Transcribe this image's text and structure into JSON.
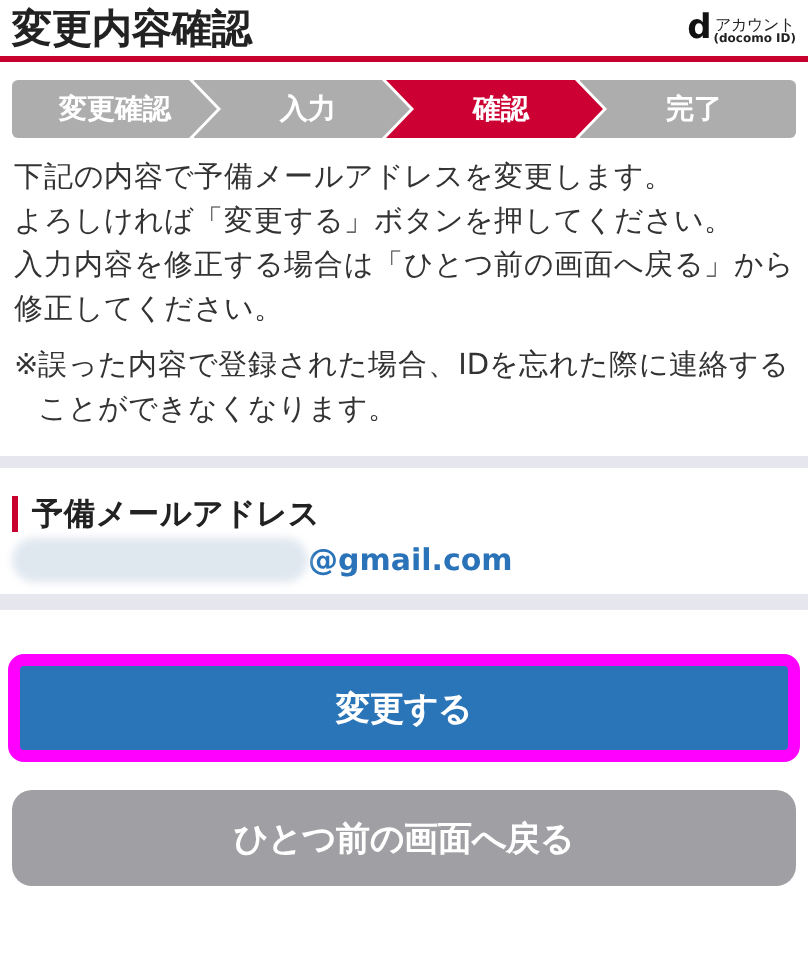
{
  "header": {
    "title": "変更内容確認",
    "logo": {
      "mark": "d",
      "name": "アカウント",
      "sub": "(docomo ID)"
    }
  },
  "steps": [
    {
      "label": "変更確認",
      "selected": false
    },
    {
      "label": "入力",
      "selected": false
    },
    {
      "label": "確認",
      "selected": true
    },
    {
      "label": "完了",
      "selected": false
    }
  ],
  "intro": [
    "下記の内容で予備メールアドレスを変更します。",
    "よろしければ「変更する」ボタンを押してください。",
    "入力内容を修正する場合は「ひとつ前の画面へ戻る」から修正してください。"
  ],
  "note": {
    "mark": "※",
    "text": "誤った内容で登録された場合、IDを忘れた際に連絡することができなくなります。"
  },
  "field": {
    "label": "予備メールアドレス",
    "value": "@gmail.com",
    "redacted": true
  },
  "buttons": [
    {
      "label": "変更する",
      "kind": "primary",
      "highlighted": true
    },
    {
      "label": "ひとつ前の画面へ戻る",
      "kind": "secondary",
      "highlighted": false
    }
  ]
}
